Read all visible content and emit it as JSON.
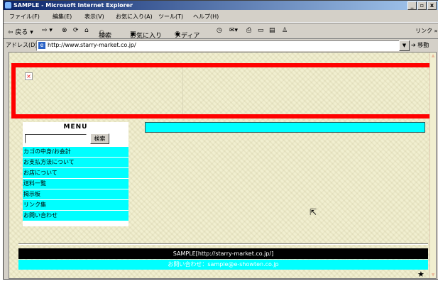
{
  "window": {
    "title": "SAMPLE - Microsoft Internet Explorer",
    "buttons": {
      "minimize": "_",
      "maximize": "▫",
      "close": "x"
    }
  },
  "menubar": {
    "items": [
      "ファイル(F)",
      "編集(E)",
      "表示(V)",
      "お気に入り(A)",
      "ツール(T)",
      "ヘルプ(H)"
    ]
  },
  "toolbar": {
    "back": "⇦ 戻る ▾",
    "forward": "⇨ ▾",
    "stop": "⊗",
    "refresh": "⟳",
    "home": "⌂",
    "search": "検索",
    "favorites": "お気に入り",
    "media": "メディア",
    "history": "◷",
    "links": "リンク »"
  },
  "addressbar": {
    "label": "アドレス(D)",
    "url": "http://www.starry-market.co.jp/",
    "go": "移動",
    "dropdown": "▼"
  },
  "page": {
    "banner_broken_image": "×",
    "menu": {
      "title": "MENU",
      "search_placeholder": "",
      "search_button": "検索",
      "items": [
        "カゴの中身/お会計",
        "お支払方法について",
        "お店について",
        "送料一覧",
        "掲示板",
        "リンク集",
        "お問い合わせ"
      ]
    },
    "footer": {
      "site": "SAMPLE[http://starry-market.co.jp/]",
      "contact": "お問い合わせ：sample@e-showten.co.jp"
    },
    "star": "★",
    "cursor": "⇱"
  },
  "colors": {
    "banner_border": "#ff0000",
    "menu_item": "#00ffff",
    "page_bg": "#f1efd0",
    "footer_black": "#000000"
  }
}
